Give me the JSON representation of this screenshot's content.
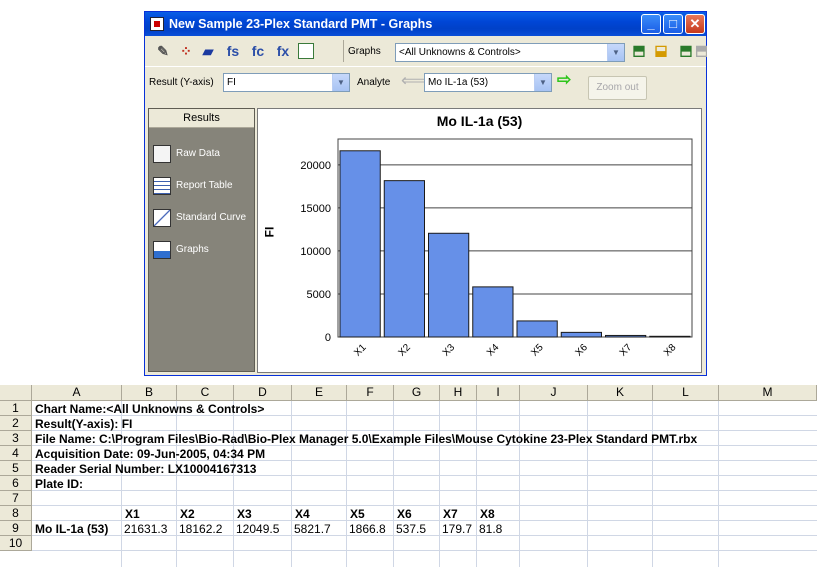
{
  "window": {
    "title": "New Sample 23-Plex Standard PMT - Graphs",
    "controls": {
      "minimize": "_",
      "maximize": "□",
      "close": "✕"
    }
  },
  "toolbar": {
    "icons": [
      "edit-icon",
      "dots-icon",
      "eraser-icon",
      "fs-icon",
      "fc-icon",
      "fx-icon",
      "grid-icon"
    ],
    "icon_glyphs": {
      "fs": "fs",
      "fc": "fc",
      "fx": "fx"
    },
    "graphs_label": "Graphs",
    "graphs_select": "<All Unknowns & Controls>"
  },
  "toolbar2": {
    "result_label": "Result (Y-axis)",
    "result_value": "FI",
    "analyte_label": "Analyte",
    "analyte_value": "Mo IL-1a (53)",
    "zoom_out": "Zoom out"
  },
  "sidebar": {
    "header": "Results",
    "items": [
      {
        "label": "Raw Data",
        "icon": "raw-data-icon"
      },
      {
        "label": "Report Table",
        "icon": "report-table-icon"
      },
      {
        "label": "Standard Curve",
        "icon": "standard-curve-icon"
      },
      {
        "label": "Graphs",
        "icon": "graphs-icon"
      }
    ]
  },
  "chart_data": {
    "type": "bar",
    "title": "Mo IL-1a (53)",
    "ylabel": "FI",
    "xlabel": "",
    "categories": [
      "X1",
      "X2",
      "X3",
      "X4",
      "X5",
      "X6",
      "X7",
      "X8"
    ],
    "values": [
      21631.3,
      18162.2,
      12049.5,
      5821.7,
      1866.8,
      537.5,
      179.7,
      81.8
    ],
    "yticks": [
      0,
      5000,
      10000,
      15000,
      20000
    ],
    "ylim": [
      0,
      23000
    ],
    "grid": true,
    "bar_color": "#6690e8"
  },
  "sheet": {
    "columns": [
      "A",
      "B",
      "C",
      "D",
      "E",
      "F",
      "G",
      "H",
      "I",
      "J",
      "K",
      "L",
      "M"
    ],
    "rows": [
      "1",
      "2",
      "3",
      "4",
      "5",
      "6",
      "7",
      "8",
      "9",
      "10"
    ],
    "r1": "Chart Name:<All Unknowns & Controls>",
    "r2": "Result(Y-axis): FI",
    "r3": "File Name: C:\\Program Files\\Bio-Rad\\Bio-Plex Manager 5.0\\Example Files\\Mouse Cytokine 23-Plex Standard PMT.rbx",
    "r4": "Acquisition Date: 09-Jun-2005, 04:34 PM",
    "r5": "Reader Serial Number: LX10004167313",
    "r6": "Plate ID:",
    "r8": [
      "X1",
      "X2",
      "X3",
      "X4",
      "X5",
      "X6",
      "X7",
      "X8"
    ],
    "r9_label": "Mo IL-1a (53)",
    "r9": [
      "21631.3",
      "18162.2",
      "12049.5",
      "5821.7",
      "1866.8",
      "537.5",
      "179.7",
      "81.8"
    ]
  }
}
